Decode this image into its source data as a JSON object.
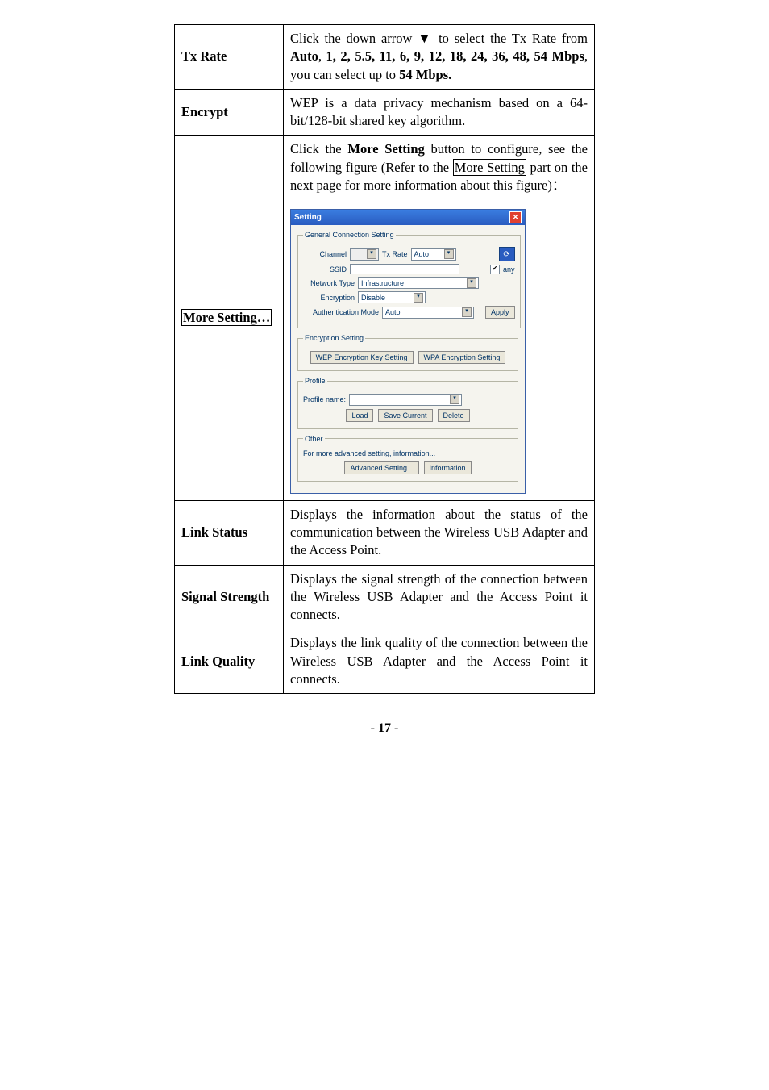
{
  "rows": {
    "txrate": {
      "label": "Tx Rate",
      "pre": "Click the down arrow ▼ to select the Tx Rate from ",
      "bold1": "Auto",
      "mid1": ", ",
      "bold2": "1, 2, 5.5, 11, 6, 9, 12, 18, 24, 36, 48, 54 Mbps",
      "mid2": ", you can select up to ",
      "bold3": "54 Mbps."
    },
    "encrypt": {
      "label": "Encrypt",
      "desc": "WEP is a data privacy mechanism based on a 64-bit/128-bit shared key algorithm."
    },
    "more": {
      "label": "More Setting…",
      "d1": "Click the ",
      "d1b": "More Setting",
      "d2": " button to configure, see the following figure (Refer to the ",
      "d2box": "More Setting",
      "d3": " part on the next page for more information about this figure)："
    },
    "link": {
      "label": "Link Status",
      "desc": "Displays the information about the status of the communication between the Wireless USB Adapter and the Access Point."
    },
    "signal": {
      "label": "Signal Strength",
      "desc": "Displays the signal strength of the connection between the Wireless USB Adapter and the Access Point it connects."
    },
    "quality": {
      "label": "Link Quality",
      "desc": "Displays the link quality of the connection between the Wireless USB Adapter and the Access Point it connects."
    }
  },
  "dialog": {
    "title": "Setting",
    "close": "✕",
    "grp1": "General Connection Setting",
    "channel_lbl": "Channel",
    "txrate_lbl": "Tx Rate",
    "txrate_val": "Auto",
    "ssid_lbl": "SSID",
    "any_lbl": "any",
    "nettype_lbl": "Network Type",
    "nettype_val": "Infrastructure",
    "enc_lbl": "Encryption",
    "enc_val": "Disable",
    "auth_lbl": "Authentication Mode",
    "auth_val": "Auto",
    "apply": "Apply",
    "grp2": "Encryption Setting",
    "wep_btn": "WEP Encryption Key Setting",
    "wpa_btn": "WPA Encryption Setting",
    "grp3": "Profile",
    "profname": "Profile name:",
    "load": "Load",
    "save": "Save Current",
    "delete": "Delete",
    "grp4": "Other",
    "othertxt": "For more advanced setting, information...",
    "adv": "Advanced Setting...",
    "info": "Information",
    "check": "✔"
  },
  "pagenum": "- 17 -"
}
